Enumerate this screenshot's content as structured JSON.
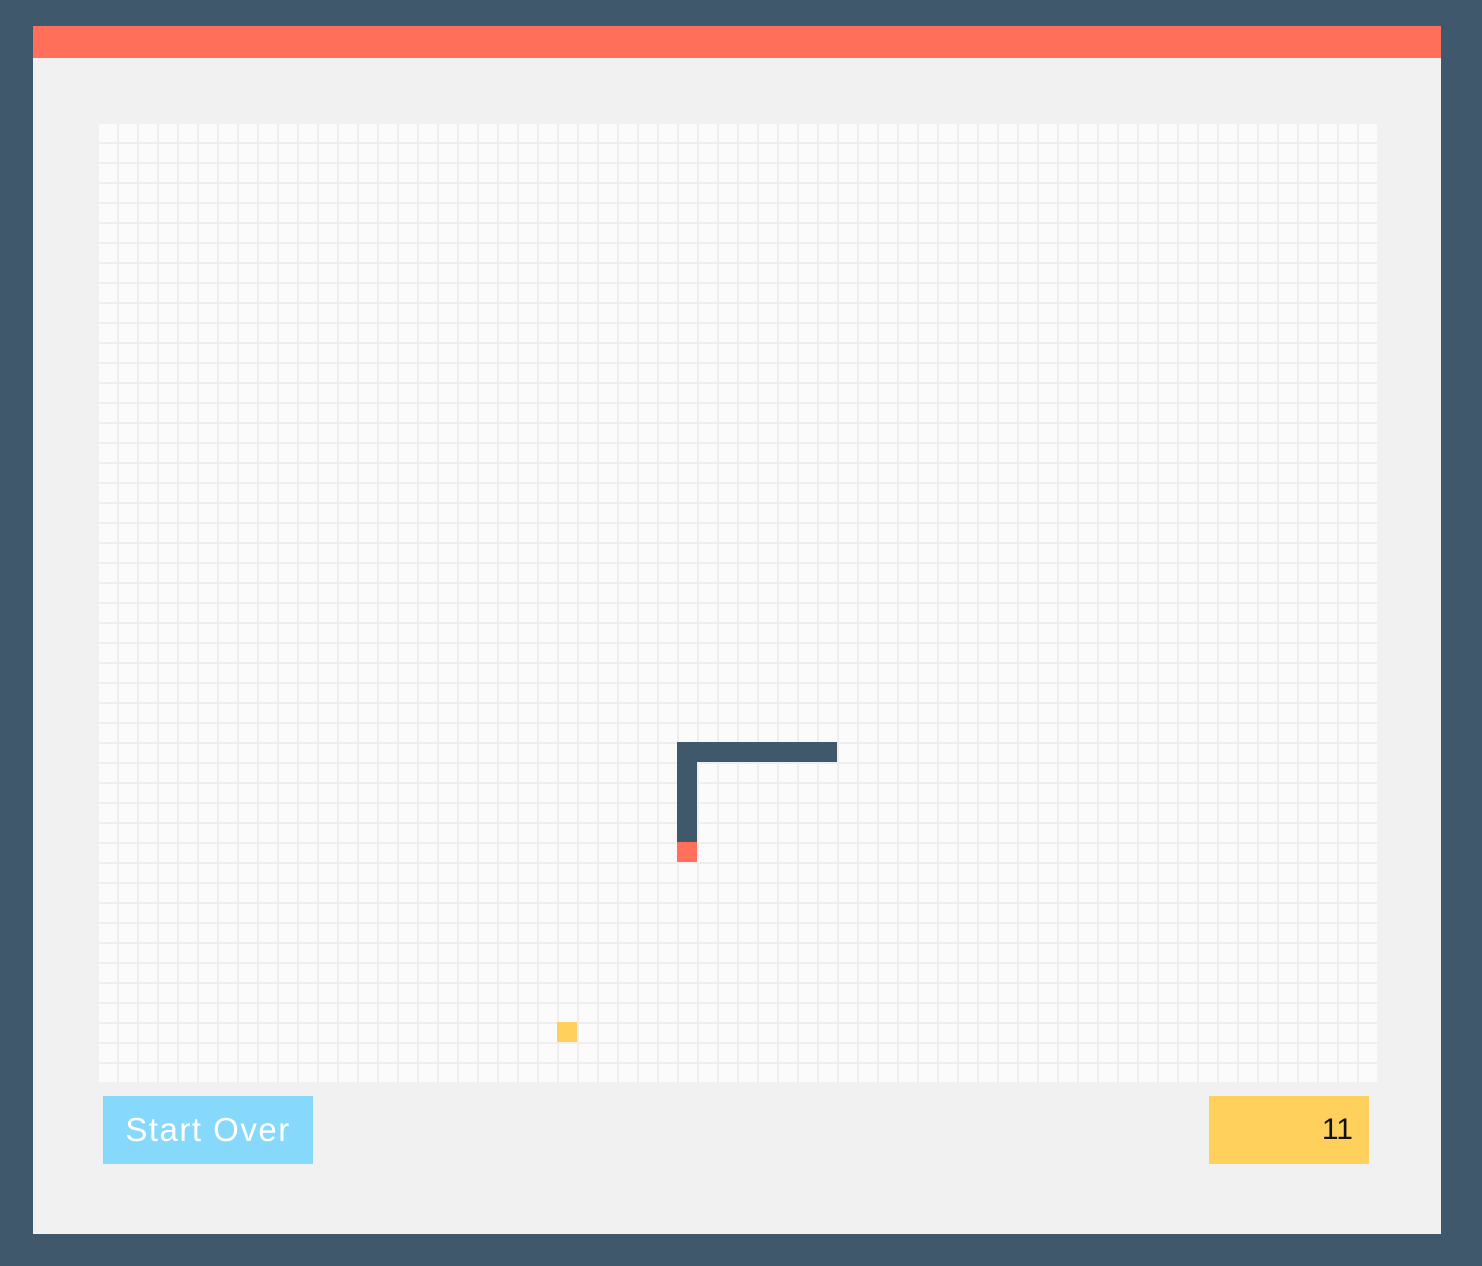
{
  "start_button": {
    "label": "Start Over"
  },
  "score": {
    "value": "11"
  },
  "colors": {
    "frame": "#3f586b",
    "top_bar": "#ff6f59",
    "panel": "#f1f1f1",
    "snake_body": "#3f586b",
    "snake_head": "#ff6f59",
    "food": "#ffd05c",
    "button": "#87d9fc",
    "score_box": "#ffd05c"
  },
  "board": {
    "columns": 64,
    "rows": 48,
    "snake": [
      [
        36,
        31
      ],
      [
        35,
        31
      ],
      [
        34,
        31
      ],
      [
        33,
        31
      ],
      [
        32,
        31
      ],
      [
        31,
        31
      ],
      [
        30,
        31
      ],
      [
        29,
        31
      ],
      [
        29,
        32
      ],
      [
        29,
        33
      ],
      [
        29,
        34
      ],
      [
        29,
        35
      ],
      [
        29,
        36
      ]
    ],
    "snake_head": [
      29,
      36
    ],
    "food": [
      23,
      45
    ]
  }
}
